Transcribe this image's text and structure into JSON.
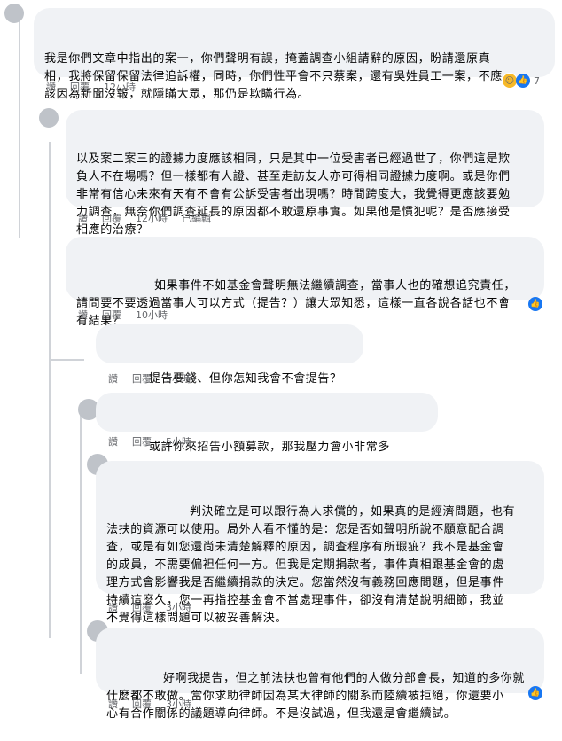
{
  "actions": {
    "like": "讚",
    "reply": "回覆",
    "edited": "已編輯"
  },
  "comments": [
    {
      "text": "我是你們文章中指出的案一，你們聲明有誤，掩蓋調查小組請辭的原因，盼請還原真\n相，我將保留保留法律追訴權，同時，你們性平會不只蔡案，還有吳姓員工一案，不應\n該因為新聞沒報，就隱瞞大眾，那仍是欺瞞行為。",
      "time": "12小時",
      "reaction_count": "7"
    },
    {
      "text": "以及案二案三的證據力度應該相同，只是其中一位受害者已經過世了，你們這是欺\n負人不在場嗎？但一樣都有人證、甚至走訪友人亦可得相同證據力度啊。或是你們\n非常有信心未來有天有不會有公訴受害者出現嗎？時間跨度大，我覺得更應該要勉\n力調查，無奈你們調查延長的原因都不敢還原事實。如果他是慣犯呢？是否應接受\n相應的治療？",
      "time": "12小時"
    },
    {
      "text": "如果事件不如基金會聲明無法繼續調查，當事人也的確想追究責任，\n請問要不要透過當事人可以方式（提告？）讓大眾知悉，這樣一直各說各話也不會\n有結果？",
      "time": "10小時"
    },
    {
      "text": "提告要錢、但你怎知我會不會提告？",
      "time": "5小時"
    },
    {
      "text": "或許你來招告小額募款，那我壓力會小非常多",
      "time": "5小時"
    },
    {
      "text": "判決確立是可以跟行為人求償的，如果真的是經濟問題，也有\n法扶的資源可以使用。局外人看不懂的是：您是否如聲明所說不願意配合調\n查，或是有如您還尚未清楚解釋的原因，調查程序有所瑕疵？我不是基金會\n的成員，不需要偏袒任何一方。但我是定期捐款者，事件真相跟基金會的處\n理方式會影響我是否繼續捐款的決定。您當然沒有義務回應問題，但是事件\n持續這麼久，您一再指控基金會不當處理事件，卻沒有清楚說明細節，我並\n不覺得這樣問題可以被妥善解決。",
      "time": "3小時"
    },
    {
      "text": "好啊我提告，但之前法扶也曾有他們的人做分部會長，知道的多你就\n什麼都不敢做。當你求助律師因為某大律師的關系而陸續被拒絕，你還要小\n心有合作關係的議題導向律師。不是沒試過，但我還是會繼續試。",
      "time": "3小時"
    }
  ]
}
